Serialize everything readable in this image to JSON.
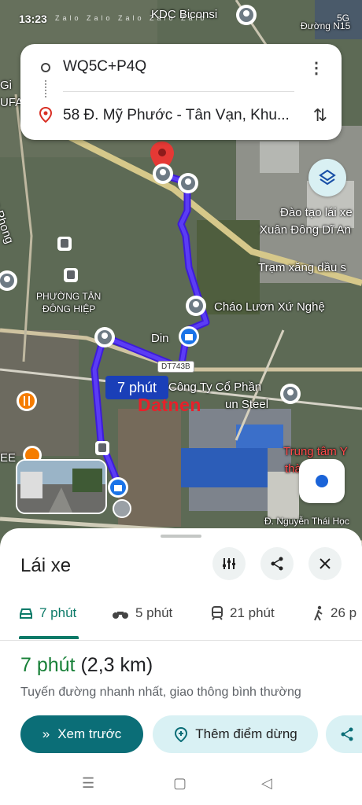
{
  "status_bar": {
    "time": "13:23",
    "notification_icons": "Zalo Zalo Zalo Zalo Zalo",
    "right_indicators": "5G"
  },
  "search": {
    "origin": "WQ5C+P4Q",
    "destination": "58 Đ. Mỹ Phước - Tân Vạn, Khu...",
    "more_icon": "more-vert-icon",
    "swap_icon": "swap-icon"
  },
  "map": {
    "labels": {
      "kdc": "KDC Biconsi",
      "duong_n15": "Đường N15",
      "hong_phong": "Hồng Phong",
      "dao_tao_1": "Đào tạo lái xe",
      "dao_tao_2": "Xuân Đông Dĩ An",
      "tram_xang": "Trạm xăng dầu s",
      "chao_luon": "Cháo Lươn Xứ Nghệ",
      "phuong_1": "PHƯỜNG TÂN",
      "phuong_2": "ĐÔNG HIỆP",
      "din": "Din",
      "cong_ty": "Công Ty Cổ Phần",
      "steel": "un Steel",
      "trung_tam": "Trung tâm Y",
      "tha": "thà",
      "nguyen_thai_hoc": "Đ. Nguyễn Thái Học",
      "gi": "Gi",
      "ufa": "UFA",
      "ee": "EE"
    },
    "road_badge": "DT743B",
    "route_time_badge": "7 phút",
    "watermark": "Datnen"
  },
  "sheet": {
    "title": "Lái xe",
    "modes": [
      {
        "icon": "car-icon",
        "label": "7 phút"
      },
      {
        "icon": "motorbike-icon",
        "label": "5 phút"
      },
      {
        "icon": "train-icon",
        "label": "21 phút"
      },
      {
        "icon": "walk-icon",
        "label": "26 p"
      }
    ],
    "route_time": "7 phút",
    "route_distance": "(2,3 km)",
    "route_description": "Tuyến đường nhanh nhất, giao thông bình thường",
    "preview_button": "Xem trước",
    "add_stop_button": "Thêm điểm dừng"
  }
}
